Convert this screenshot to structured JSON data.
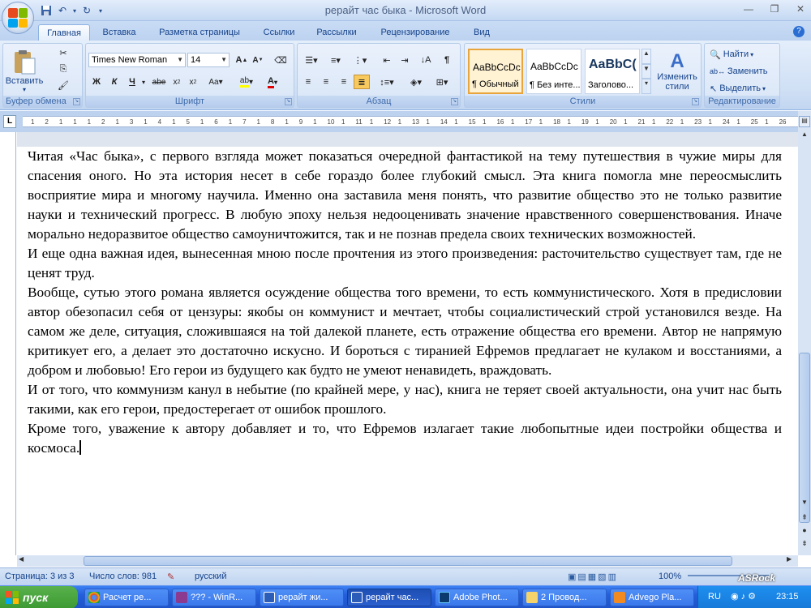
{
  "window": {
    "title": "рерайт час быка - Microsoft Word"
  },
  "tabs": [
    "Главная",
    "Вставка",
    "Разметка страницы",
    "Ссылки",
    "Рассылки",
    "Рецензирование",
    "Вид"
  ],
  "ribbon": {
    "clipboard": {
      "label": "Буфер обмена",
      "paste": "Вставить"
    },
    "font": {
      "label": "Шрифт",
      "font_name": "Times New Roman",
      "font_size": "14"
    },
    "paragraph": {
      "label": "Абзац"
    },
    "styles": {
      "label": "Стили",
      "items": [
        {
          "sample": "AaBbCcDc",
          "name": "¶ Обычный"
        },
        {
          "sample": "AaBbCcDc",
          "name": "¶ Без инте..."
        },
        {
          "sample": "AaBbC(",
          "name": "Заголово..."
        }
      ],
      "change_styles": "Изменить стили"
    },
    "editing": {
      "label": "Редактирование",
      "find": "Найти",
      "replace": "Заменить",
      "select": "Выделить"
    }
  },
  "ruler": {
    "ticks": [
      "1",
      "2",
      "1",
      "1",
      "1",
      "2",
      "1",
      "3",
      "1",
      "4",
      "1",
      "5",
      "1",
      "6",
      "1",
      "7",
      "1",
      "8",
      "1",
      "9",
      "1",
      "10",
      "1",
      "11",
      "1",
      "12",
      "1",
      "13",
      "1",
      "14",
      "1",
      "15",
      "1",
      "16",
      "1",
      "17",
      "1",
      "18",
      "1",
      "19",
      "1",
      "20",
      "1",
      "21",
      "1",
      "22",
      "1",
      "23",
      "1",
      "24",
      "1",
      "25",
      "1",
      "26"
    ]
  },
  "document": {
    "paragraphs": [
      "Читая «Час быка», с первого взгляда может показаться очередной фантастикой на тему путешествия в чужие миры для спасения оного. Но эта история несет в себе гораздо более глубокий смысл. Эта книга помогла мне переосмыслить восприятие мира и многому научила. Именно она заставила меня понять, что  развитие общество это не только развитие науки и технический прогресс. В любую эпоху нельзя  недооценивать значение нравственного совершенствования. Иначе морально недоразвитое общество самоуничтожится, так и не познав предела своих технических возможностей.",
      "И еще одна важная идея, вынесенная мною после прочтения из этого произведения: расточительство существует там, где не ценят труд.",
      "Вообще, сутью этого романа является осуждение общества того времени, то есть коммунистического. Хотя в предисловии автор обезопасил себя от цензуры: якобы он коммунист и мечтает, чтобы социалистический строй установился везде. На самом же деле, ситуация, сложившаяся на той далекой планете, есть отражение общества его времени. Автор не напрямую критикует его, а делает это достаточно искусно. И бороться с тиранией Ефремов предлагает не кулаком и восстаниями, а добром и любовью! Его герои из будущего как будто не умеют ненавидеть, враждовать.",
      "И от того, что коммунизм канул в небытие (по крайней мере, у нас), книга не теряет своей актуальности, она учит нас быть такими, как его герои, предостерегает от ошибок прошлого.",
      "Кроме того, уважение к автору добавляет и то, что Ефремов излагает такие любопытные идеи постройки общества и космоса."
    ]
  },
  "status": {
    "page": "Страница: 3 из 3",
    "words": "Число слов: 981",
    "language": "русский",
    "zoom": "100%"
  },
  "taskbar": {
    "start": "пуск",
    "tasks": [
      "Расчет ре...",
      "??? - WinR...",
      "рерайт жи...",
      "рерайт час...",
      "Adobe Phot...",
      "2 Провод...",
      "Advego Pla..."
    ],
    "lang": "RU",
    "clock": "23:15",
    "brand": "ASRock"
  }
}
